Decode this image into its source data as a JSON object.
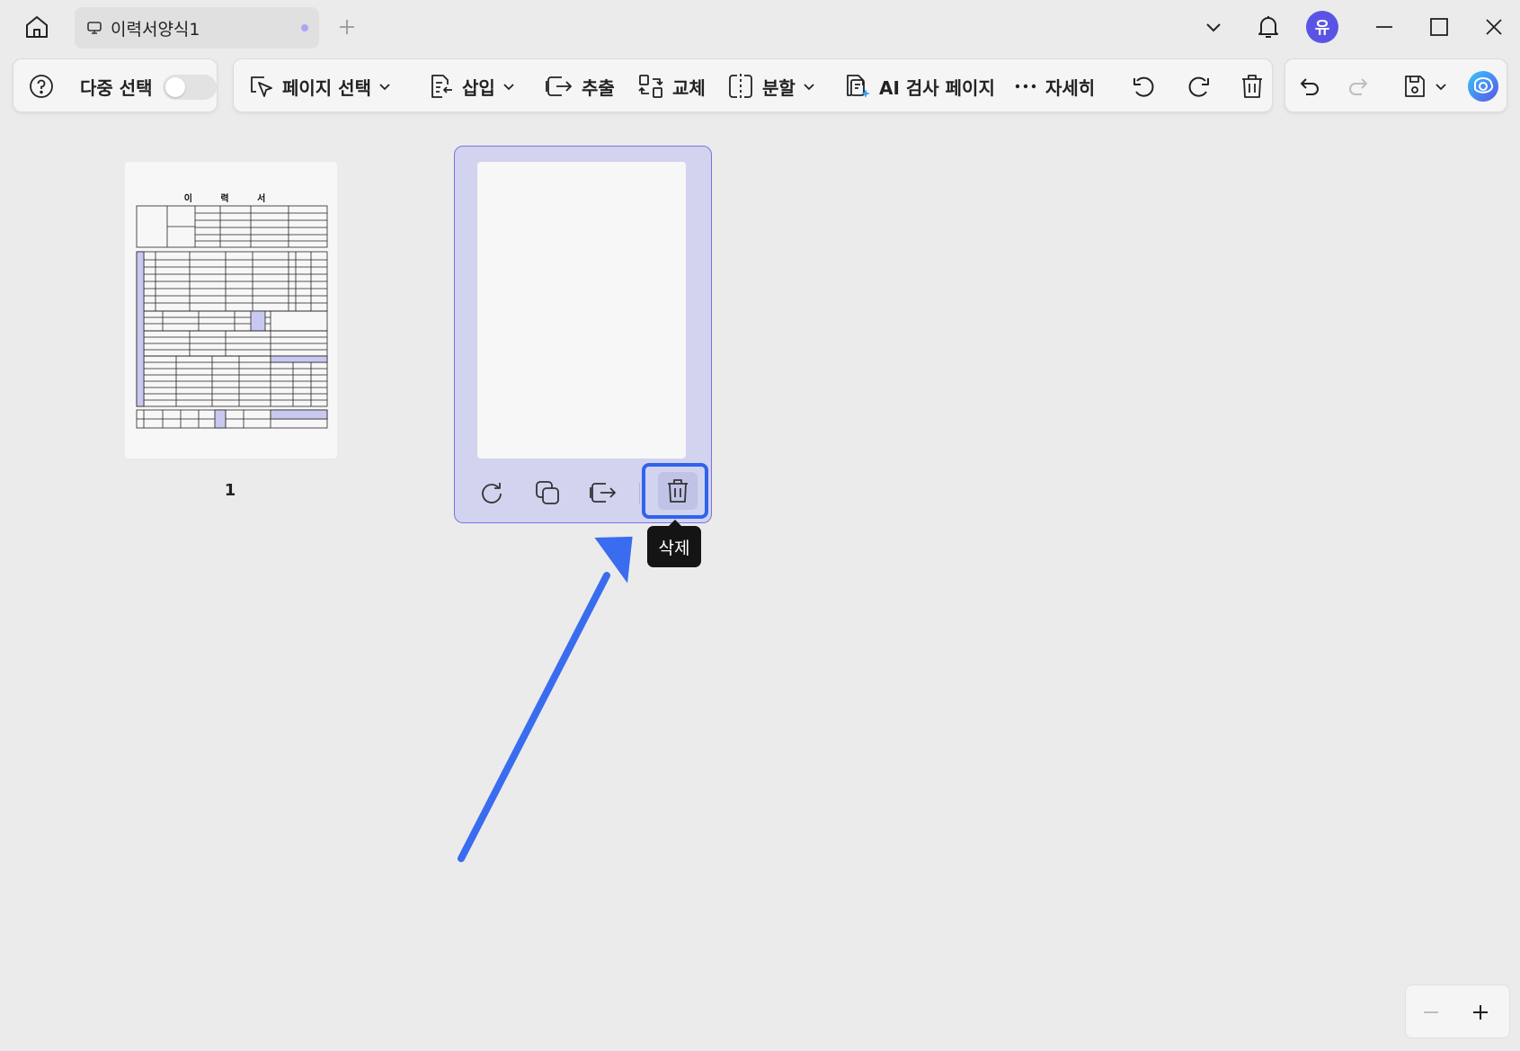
{
  "titlebar": {
    "tab_title": "이력서양식1",
    "avatar_initial": "유"
  },
  "toolbar": {
    "multi_select_label": "다중 선택",
    "multi_select_on": false,
    "page_select_label": "페이지 선택",
    "insert_label": "삽입",
    "extract_label": "추출",
    "replace_label": "교체",
    "split_label": "분할",
    "ai_check_label": "AI 검사 페이지",
    "more_label": "자세히"
  },
  "thumbnails": {
    "page1": {
      "number": "1",
      "doc_title": "이 력 서"
    }
  },
  "selected_page": {
    "tooltip": "삭제"
  },
  "colors": {
    "accent": "#5a54e6",
    "selection_bg": "#d2d3ef",
    "selection_border": "#7d72e6",
    "highlight": "#2f63ee",
    "arrow": "#3a6cf0"
  }
}
